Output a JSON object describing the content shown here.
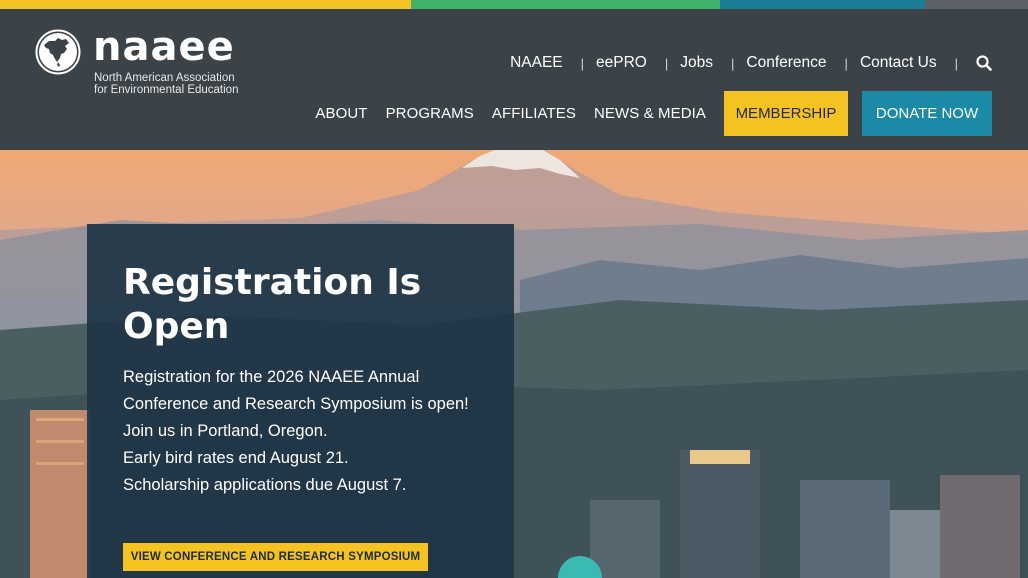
{
  "colors": {
    "bar_yellow": "#f4c321",
    "bar_green": "#3fb36b",
    "bar_teal": "#1a7d96",
    "bar_gray": "#5d6166",
    "header_bg": "#3b4349",
    "membership_bg": "#f4c321",
    "donate_bg": "#1a8aa6"
  },
  "brand": {
    "name": "naaee",
    "subtitle_line1": "North American Association",
    "subtitle_line2": "for Environmental Education",
    "logo_icon": "north-america-globe-icon"
  },
  "utility_nav": {
    "items": [
      "NAAEE",
      "eePRO",
      "Jobs",
      "Conference",
      "Contact Us"
    ],
    "separator": "|",
    "search_icon": "search-icon"
  },
  "main_nav": {
    "items": [
      "ABOUT",
      "PROGRAMS",
      "AFFILIATES",
      "NEWS & MEDIA"
    ],
    "membership_label": "MEMBERSHIP",
    "donate_label": "DONATE NOW"
  },
  "hero": {
    "title": "Registration Is Open",
    "lines": [
      "Registration for the 2026 NAAEE Annual Conference and Research Symposium is open!",
      "Join us in Portland, Oregon.",
      "Early bird rates end August 21.",
      "Scholarship applications due August 7."
    ],
    "cta_label": "VIEW CONFERENCE AND RESEARCH SYMPOSIUM"
  }
}
